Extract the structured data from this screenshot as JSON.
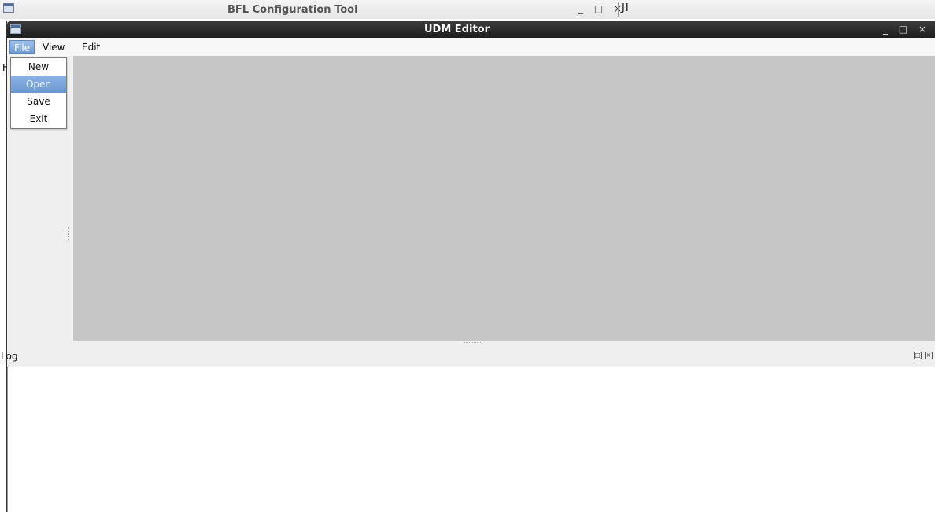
{
  "background_window": {
    "title": "BFL Configuration Tool",
    "controls": "_ □ ×",
    "partial_text": "JI"
  },
  "window": {
    "title": "UDM Editor",
    "controls": "_ □ ×"
  },
  "menubar": {
    "items": [
      "File",
      "View",
      "Edit"
    ]
  },
  "file_menu": {
    "items": [
      "New",
      "Open",
      "Save",
      "Exit"
    ],
    "selected": "Open"
  },
  "left_panel": {
    "fragment": "F"
  },
  "log_panel": {
    "title": "Log"
  },
  "colors": {
    "titlebar_dark": "#1e1e1e",
    "editor_gray": "#c6c6c6",
    "highlight_blue": "#6a98d2"
  },
  "icons": [
    "window-icon",
    "float-icon",
    "close-icon"
  ]
}
